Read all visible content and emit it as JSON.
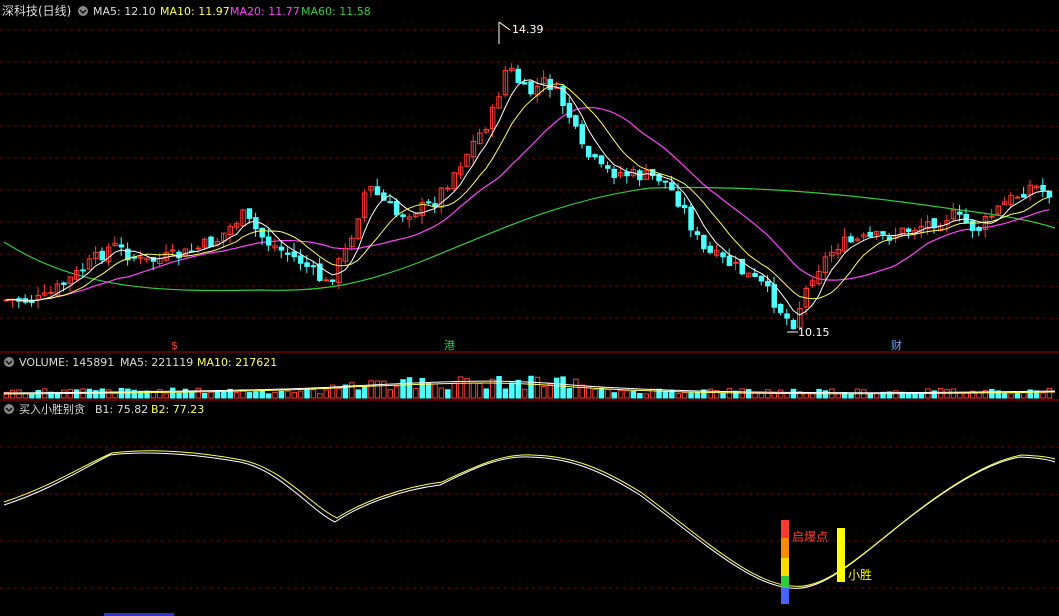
{
  "price_panel": {
    "title": "深科技(日线)",
    "ma5_label": "MA5: 12.10",
    "ma10_label": "MA10: 11.97",
    "ma20_label": "MA20: 11.77",
    "ma60_label": "MA60: 11.58",
    "high_marker": "14.39",
    "low_marker": "10.15",
    "event_markers": [
      "$",
      "港",
      "财"
    ],
    "colors": {
      "up": "#ff3b30",
      "down": "#4dffff",
      "ma5": "#ffffff",
      "ma10": "#ffff55",
      "ma20": "#ff44ff",
      "ma60": "#2ecc40"
    }
  },
  "volume_panel": {
    "title": "VOLUME: 145891",
    "ma5_label": "MA5: 221119",
    "ma10_label": "MA10: 217621"
  },
  "indicator_panel": {
    "title": "买入小胜别贪",
    "b1_label": "B1: 75.82",
    "b2_label": "B2: 77.23",
    "signal_label": "启爆点",
    "target_label": "小胜"
  },
  "chart_data": [
    {
      "type": "candlestick",
      "title": "深科技(日线)",
      "y_high": 14.39,
      "y_low": 10.15,
      "series": [
        {
          "name": "MA5",
          "last": 12.1
        },
        {
          "name": "MA10",
          "last": 11.97
        },
        {
          "name": "MA20",
          "last": 11.77
        },
        {
          "name": "MA60",
          "last": 11.58
        }
      ]
    },
    {
      "type": "bar",
      "title": "VOLUME",
      "series": [
        {
          "name": "VOLUME",
          "last": 145891
        },
        {
          "name": "MA5",
          "last": 221119
        },
        {
          "name": "MA10",
          "last": 217621
        }
      ]
    },
    {
      "type": "line",
      "title": "买入小胜别贪",
      "series": [
        {
          "name": "B1",
          "last": 75.82
        },
        {
          "name": "B2",
          "last": 77.23
        }
      ]
    }
  ]
}
